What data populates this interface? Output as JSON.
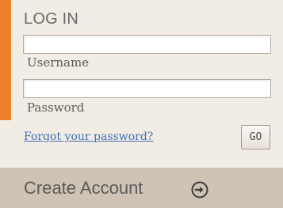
{
  "login": {
    "heading": "LOG IN",
    "username_label": "Username",
    "username_value": "",
    "password_label": "Password",
    "password_value": "",
    "forgot_link": "Forgot your password?",
    "go_label": "GO"
  },
  "create_account": {
    "label": "Create Account",
    "icon": "arrow-right-circle-icon"
  },
  "colors": {
    "accent": "#ee7f2d",
    "panel_bg": "#f1ece4",
    "create_bg": "#cec3b4",
    "link": "#3f6fb6"
  }
}
